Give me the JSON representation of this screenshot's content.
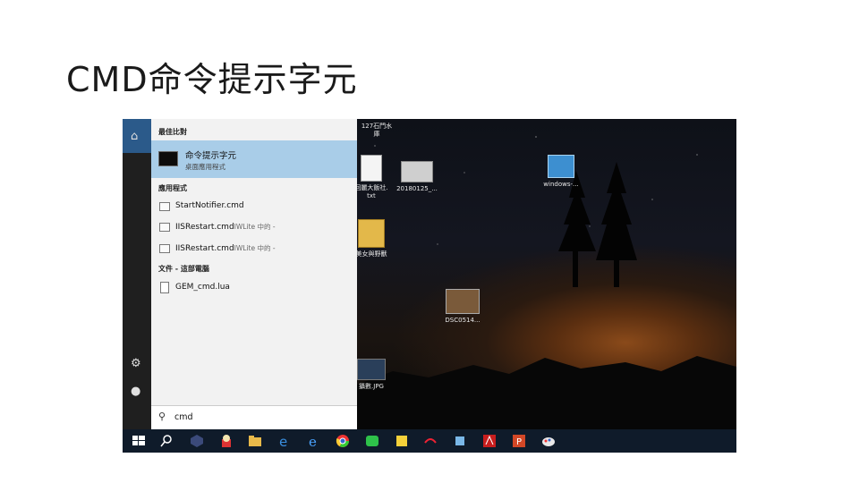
{
  "slide": {
    "title": "CMD命令提示字元"
  },
  "start_menu": {
    "best_match_header": "最佳比對",
    "best_match": {
      "title": "命令提示字元",
      "subtitle": "桌面應用程式"
    },
    "apps_header": "應用程式",
    "apps": [
      {
        "name": "StartNotifier.cmd",
        "suffix": ""
      },
      {
        "name": "IISRestart.cmd",
        "suffix": "IWLite 中的 -"
      },
      {
        "name": "IISRestart.cmd",
        "suffix": "IWLite 中的 -"
      }
    ],
    "files_header": "文件 - 這部電腦",
    "files": [
      {
        "name": "GEM_cmd.lua"
      }
    ],
    "search_query": "cmd"
  },
  "desktop": {
    "icons": [
      {
        "label": "127石門水\n庫"
      },
      {
        "label": "回麗大飯社.\ntxt"
      },
      {
        "label": "20180125_..."
      },
      {
        "label": "windows-..."
      },
      {
        "label": "美女與野獸"
      },
      {
        "label": "DSC0514..."
      },
      {
        "label": "攝數.JPG"
      }
    ]
  },
  "taskbar": {
    "icons": [
      "windows-start-icon",
      "search-icon",
      "app-icon",
      "popcorn-icon",
      "file-explorer-icon",
      "edge-icon",
      "ie-icon",
      "chrome-icon",
      "line-icon",
      "sticky-icon",
      "app-red-icon",
      "app-blue-icon",
      "acrobat-icon",
      "powerpoint-icon",
      "paint-icon"
    ]
  },
  "colors": {
    "accent": "#a9cde8",
    "panel": "#f2f2f2",
    "taskbar": "#0f1b2a",
    "home": "#2b5a8a"
  }
}
